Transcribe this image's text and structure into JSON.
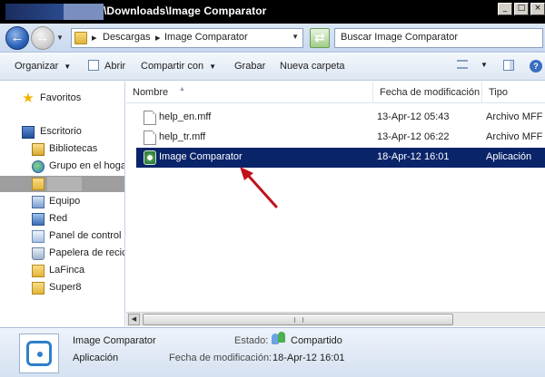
{
  "window": {
    "title": "\\Downloads\\Image Comparator",
    "controls": [
      "_",
      "□",
      "×"
    ]
  },
  "address": {
    "crumbs": [
      "Descargas",
      "Image Comparator"
    ],
    "search_placeholder": "Buscar Image Comparator"
  },
  "toolbar": {
    "organize": "Organizar",
    "open": "Abrir",
    "share": "Compartir con",
    "burn": "Grabar",
    "new_folder": "Nueva carpeta"
  },
  "nav": {
    "favorites": "Favoritos",
    "desktop": "Escritorio",
    "libraries": "Bibliotecas",
    "homegroup": "Grupo en el hoga",
    "computer": "Equipo",
    "network": "Red",
    "control_panel": "Panel de control",
    "recycle_bin": "Papelera de recic",
    "lafinca": "LaFinca",
    "super8": "Super8"
  },
  "columns": {
    "name": "Nombre",
    "modified": "Fecha de modificación",
    "type": "Tipo"
  },
  "files": [
    {
      "name": "help_en.mff",
      "modified": "13-Apr-12 05:43",
      "type": "Archivo MFF",
      "icon": "document-icon"
    },
    {
      "name": "help_tr.mff",
      "modified": "13-Apr-12 06:22",
      "type": "Archivo MFF",
      "icon": "document-icon"
    },
    {
      "name": "Image Comparator",
      "modified": "18-Apr-12 16:01",
      "type": "Aplicación",
      "icon": "app-icon"
    }
  ],
  "details": {
    "name": "Image Comparator",
    "type": "Aplicación",
    "state_label": "Estado:",
    "state_value": "Compartido",
    "modified_label": "Fecha de modificación:",
    "modified_value": "18-Apr-12 16:01"
  },
  "colors": {
    "selection": "#0a246a",
    "annotation_arrow": "#c0121b"
  }
}
